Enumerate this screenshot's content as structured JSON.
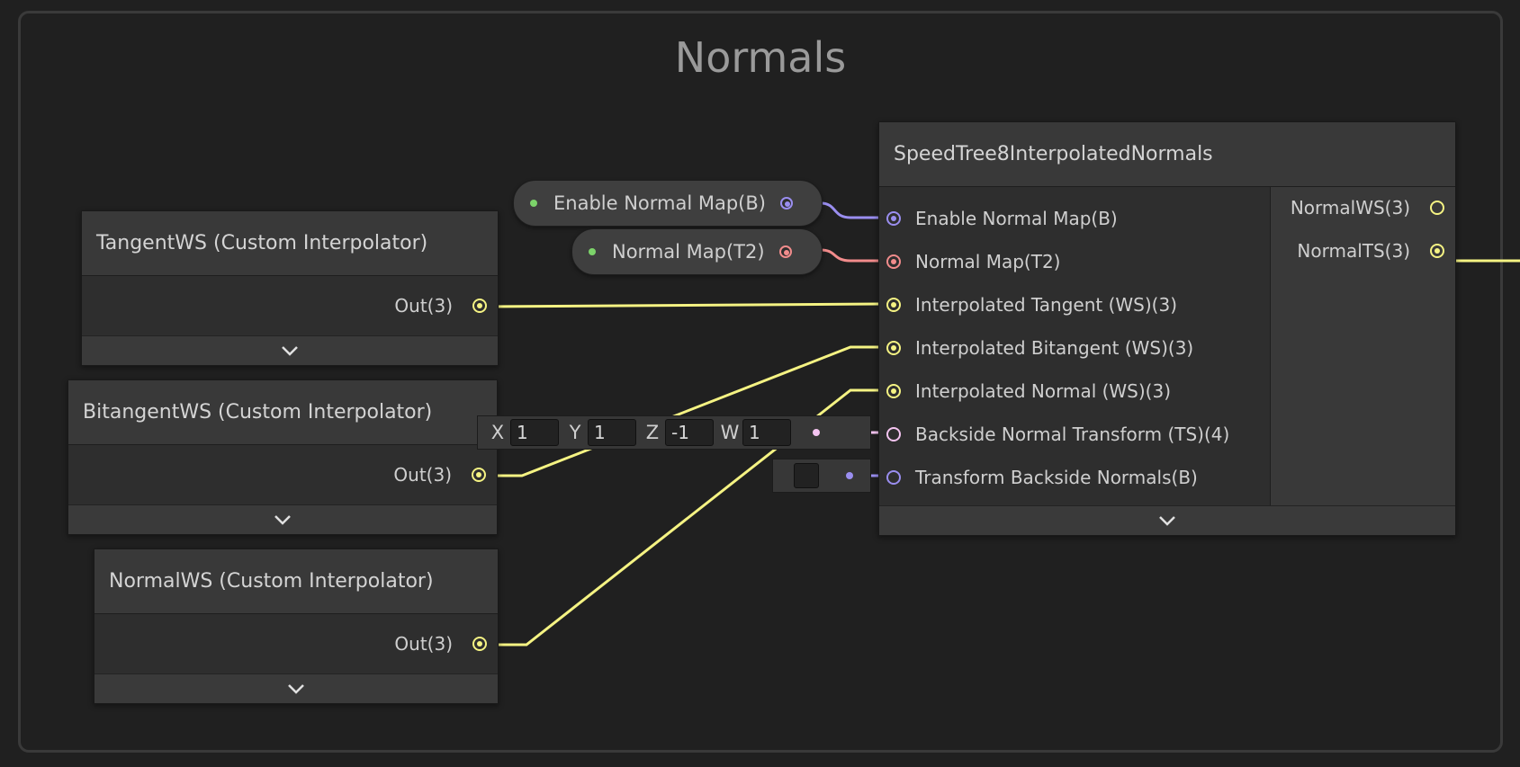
{
  "group": {
    "title": "Normals"
  },
  "colors": {
    "vector3": "#f5f383",
    "boolean": "#9a8ef0",
    "texture2d": "#f28c8c",
    "vector4": "#f4c4f0",
    "node_bg": "#2d2d2d",
    "header_bg": "#393939"
  },
  "nodes": {
    "tangent": {
      "title": "TangentWS (Custom Interpolator)",
      "output": "Out(3)"
    },
    "bitangent": {
      "title": "BitangentWS (Custom Interpolator)",
      "output": "Out(3)"
    },
    "normal": {
      "title": "NormalWS (Custom Interpolator)",
      "output": "Out(3)"
    },
    "speedtree": {
      "title": "SpeedTree8InterpolatedNormals",
      "inputs": [
        "Enable Normal Map(B)",
        "Normal Map(T2)",
        "Interpolated Tangent (WS)(3)",
        "Interpolated Bitangent (WS)(3)",
        "Interpolated Normal (WS)(3)",
        "Backside Normal Transform (TS)(4)",
        "Transform Backside Normals(B)"
      ],
      "outputs": [
        "NormalWS(3)",
        "NormalTS(3)"
      ]
    }
  },
  "properties": {
    "enable_normal_map": "Enable Normal Map(B)",
    "normal_map": "Normal Map(T2)"
  },
  "vector_field": {
    "x_label": "X",
    "x": "1",
    "y_label": "Y",
    "y": "1",
    "z_label": "Z",
    "z": "-1",
    "w_label": "W",
    "w": "1"
  },
  "toggle": {
    "checked": false
  }
}
